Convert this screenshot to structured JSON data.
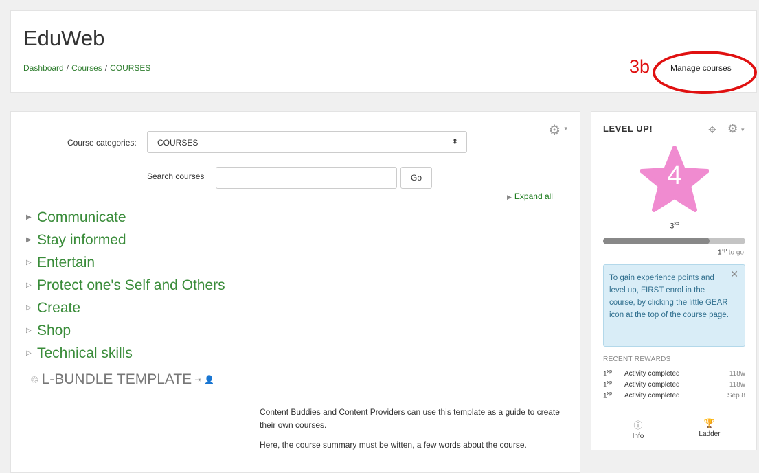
{
  "header": {
    "site_title": "EduWeb",
    "breadcrumb": [
      "Dashboard",
      "Courses",
      "COURSES"
    ],
    "separator": "/",
    "annotation_label": "3b",
    "manage_courses": "Manage courses"
  },
  "main": {
    "category_label": "Course categories:",
    "category_value": "COURSES",
    "search_label": "Search courses",
    "search_placeholder": "",
    "go_label": "Go",
    "expand_all": "Expand all",
    "categories": [
      "Communicate",
      "Stay informed",
      "Entertain",
      "Protect one's Self and Others",
      "Create",
      "Shop",
      "Technical skills"
    ],
    "course_title": "L-BUNDLE TEMPLATE",
    "summary": [
      "Content Buddies and Content Providers can use this template as a guide to create their own courses.",
      "Here, the course summary must be witten, a few words about the course."
    ]
  },
  "level_block": {
    "title": "LEVEL UP!",
    "level": "4",
    "xp_value": "3",
    "xp_unit": "xp",
    "progress_fraction": 0.75,
    "to_go_value": "1",
    "to_go_text": "to go",
    "notice": "To gain experience points and level up, FIRST enrol in the course, by clicking the little GEAR icon at the top of the course page.",
    "recent_rewards_title": "RECENT REWARDS",
    "rewards": [
      {
        "points": "1",
        "desc": "Activity completed",
        "time": "118w"
      },
      {
        "points": "1",
        "desc": "Activity completed",
        "time": "118w"
      },
      {
        "points": "1",
        "desc": "Activity completed",
        "time": "Sep 8"
      }
    ],
    "info_label": "Info",
    "ladder_label": "Ladder"
  },
  "colors": {
    "link_green": "#3a8c3a",
    "annotation_red": "#e01010",
    "star_pink": "#f08bd0",
    "notice_bg": "#d9edf7"
  },
  "icons": [
    "gear-icon",
    "move-icon",
    "star-icon",
    "close-icon",
    "info-icon",
    "trophy-icon",
    "login-icon",
    "user-icon",
    "recycle-icon"
  ]
}
